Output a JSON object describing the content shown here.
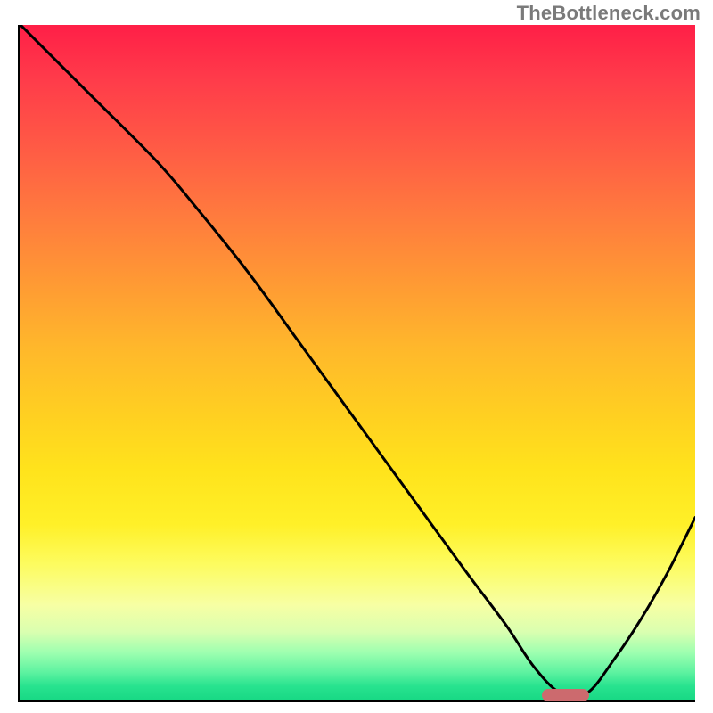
{
  "watermark": "TheBottleneck.com",
  "chart_data": {
    "type": "line",
    "title": "",
    "xlabel": "",
    "ylabel": "",
    "xlim": [
      0,
      100
    ],
    "ylim": [
      0,
      100
    ],
    "series": [
      {
        "name": "bottleneck-curve",
        "x": [
          0,
          10,
          20,
          26,
          34,
          42,
          50,
          58,
          66,
          72,
          76,
          80,
          84,
          88,
          92,
          96,
          100
        ],
        "values": [
          100,
          90,
          80,
          73,
          63,
          52,
          41,
          30,
          19,
          11,
          5,
          1,
          1,
          6,
          12,
          19,
          27
        ]
      }
    ],
    "gradient_stops": [
      {
        "pos": 0,
        "color": "#ff1f47"
      },
      {
        "pos": 50,
        "color": "#ffd021"
      },
      {
        "pos": 80,
        "color": "#fdfc60"
      },
      {
        "pos": 100,
        "color": "#19d985"
      }
    ],
    "marker": {
      "x_start": 77,
      "x_end": 84,
      "y": 1
    }
  }
}
